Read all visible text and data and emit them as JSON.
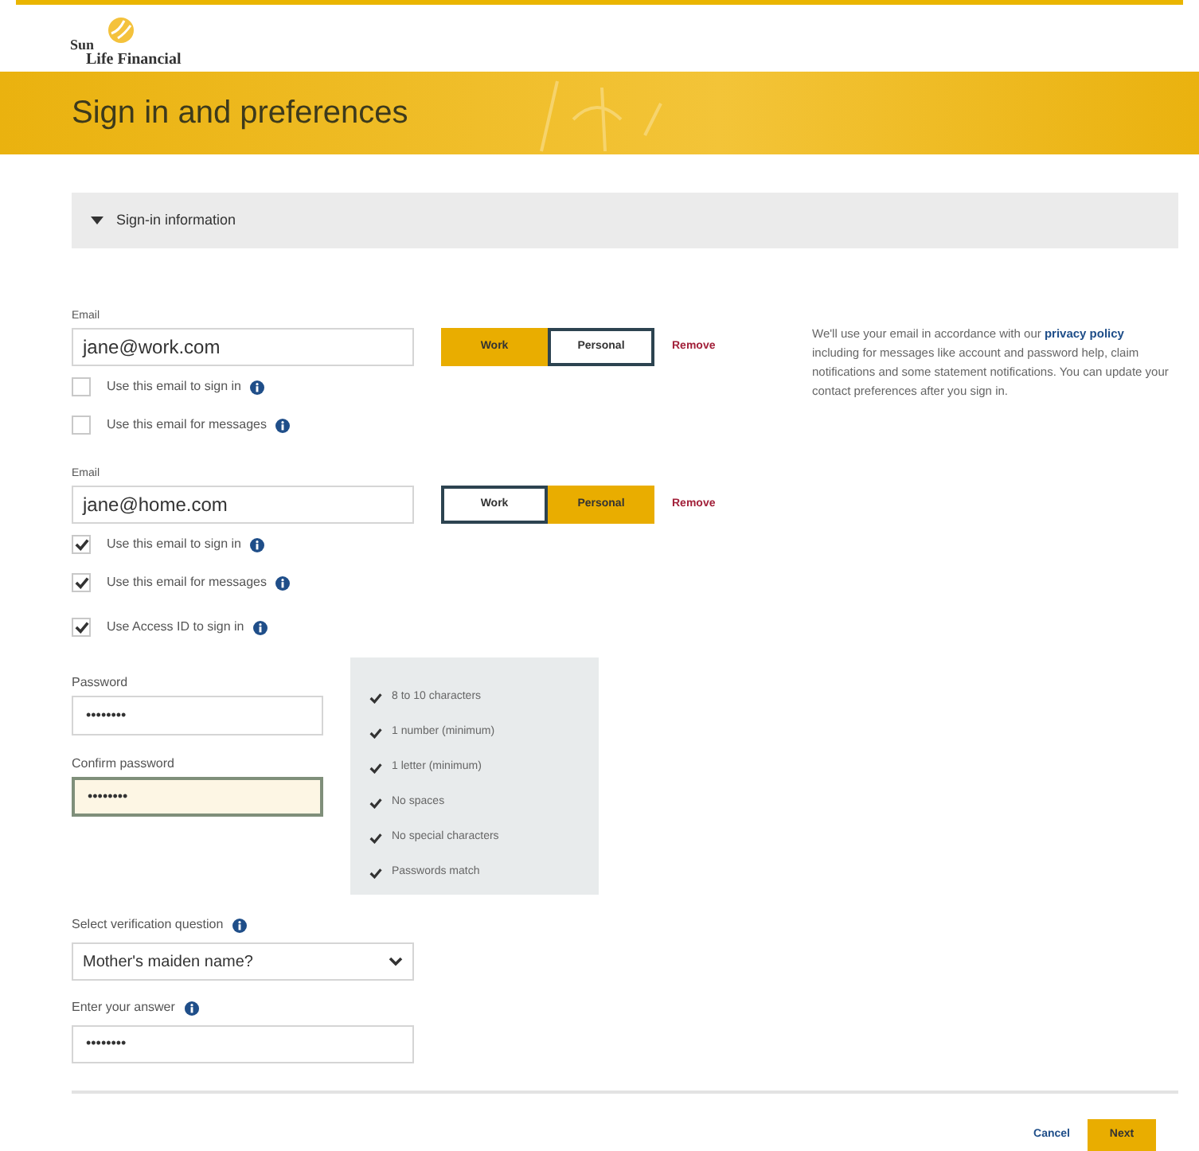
{
  "logo": {
    "line1": "Sun",
    "line2": "Life Financial"
  },
  "banner": {
    "title": "Sign in and preferences"
  },
  "section": {
    "title": "Sign-in information",
    "expanded": true
  },
  "emails": [
    {
      "label": "Email",
      "value": "jane@work.com",
      "types": [
        {
          "label": "Work",
          "selected": true
        },
        {
          "label": "Personal",
          "selected": false
        }
      ],
      "remove": "Remove",
      "options": [
        {
          "label": "Use this email to sign in",
          "checked": false
        },
        {
          "label": "Use this email for messages",
          "checked": false
        }
      ]
    },
    {
      "label": "Email",
      "value": "jane@home.com",
      "types": [
        {
          "label": "Work",
          "selected": false
        },
        {
          "label": "Personal",
          "selected": true
        }
      ],
      "remove": "Remove",
      "options": [
        {
          "label": "Use this email to sign in",
          "checked": true
        },
        {
          "label": "Use this email for messages",
          "checked": true
        }
      ]
    }
  ],
  "access_id": {
    "label": "Use Access ID to sign in",
    "checked": true
  },
  "note": {
    "before": "We'll use your email in accordance with our",
    "link": "privacy policy",
    "after": "including for messages like account and password help, claim notifications and some statement notifications. You can update your contact preferences after you sign in."
  },
  "passwords": [
    {
      "label": "Password",
      "value": "••••••••",
      "focused": false
    },
    {
      "label": "Confirm password",
      "value": "••••••••",
      "focused": true
    }
  ],
  "requirements": [
    {
      "text": "8 to 10 characters",
      "met": true
    },
    {
      "text": "1 number (minimum)",
      "met": true
    },
    {
      "text": "1 letter (minimum)",
      "met": true
    },
    {
      "text": "No spaces",
      "met": true
    },
    {
      "text": "No special characters",
      "met": true
    },
    {
      "text": "Passwords match",
      "met": true
    }
  ],
  "question": {
    "label": "Select verification question",
    "value": "Mother's maiden name?"
  },
  "answer": {
    "label": "Enter your answer",
    "value": "••••••••"
  },
  "buttons": {
    "cancel": "Cancel",
    "next": "Next"
  }
}
